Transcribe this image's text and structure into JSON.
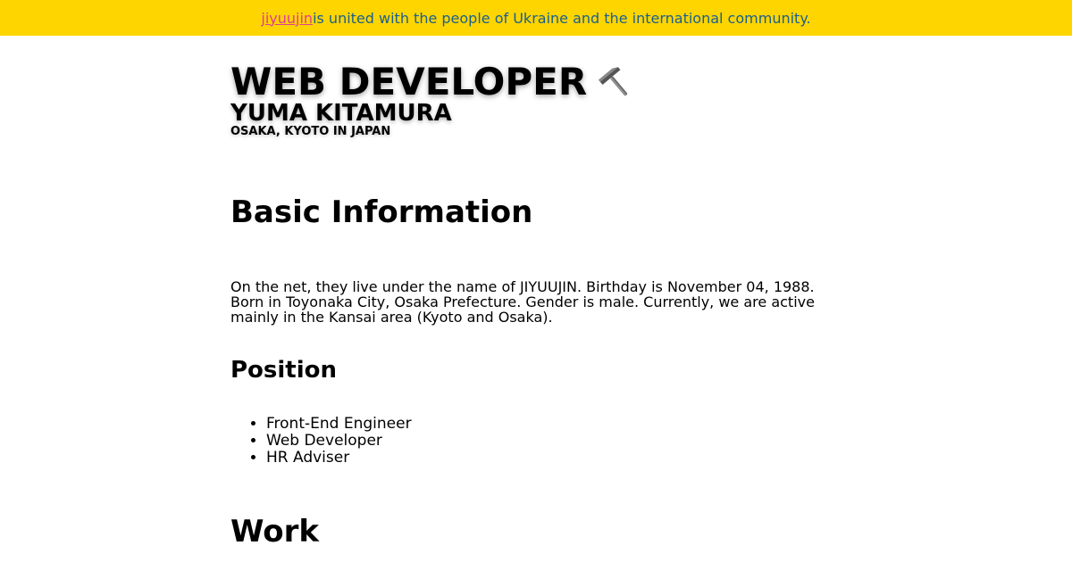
{
  "banner": {
    "link_text": "jiyuujin",
    "message": "is united with the people of Ukraine and the international community."
  },
  "hero": {
    "title": "WEB DEVELOPER",
    "icon": "hammer-icon",
    "name": "YUMA KITAMURA",
    "location": "OSAKA, KYOTO IN JAPAN"
  },
  "basic_info": {
    "heading": "Basic Information",
    "paragraph": "On the net, they live under the name of JIYUUJIN. Birthday is November 04, 1988. Born in Toyonaka City, Osaka Prefecture. Gender is male. Currently, we are active mainly in the Kansai area (Kyoto and Osaka)."
  },
  "position": {
    "heading": "Position",
    "items": [
      "Front-End Engineer",
      "Web Developer",
      "HR Adviser"
    ]
  },
  "work": {
    "heading": "Work"
  },
  "colors": {
    "banner_bg": "#ffd500",
    "banner_text": "#1a5f8f",
    "link": "#e23c96"
  }
}
